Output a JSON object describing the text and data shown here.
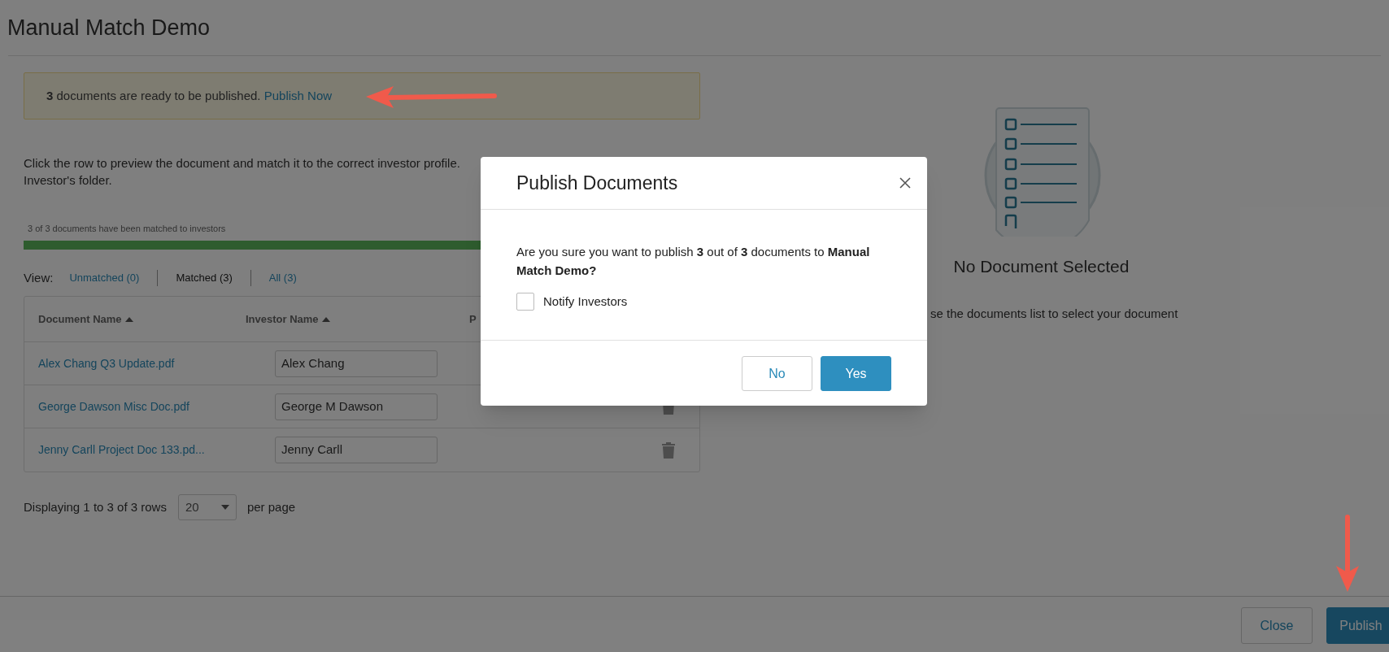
{
  "page": {
    "title": "Manual Match Demo"
  },
  "banner": {
    "message": "**3** documents are ready to be published.",
    "link": "Publish Now"
  },
  "instructions": [
    "Click the row to preview the document and match it to the correct investor profile.",
    "Investor's folder."
  ],
  "progress": {
    "label": "3 of 3 documents have been matched to investors",
    "level": 1
  },
  "view_filter": {
    "label": "View:",
    "options": [
      {
        "label": "Unmatched (0)",
        "selected": false
      },
      {
        "label": "Matched (3)",
        "selected": true
      },
      {
        "label": "All (3)",
        "selected": false
      }
    ]
  },
  "table": {
    "columns": [
      {
        "label": "Document Name",
        "sorted": true
      },
      {
        "label": "Investor Name",
        "sorted": true
      },
      {
        "label": "P",
        "sorted": false
      }
    ],
    "rows": [
      {
        "document": "Alex Chang Q3 Update.pdf",
        "investor": "Alex Chang",
        "trash_icon": false
      },
      {
        "document": "George Dawson Misc Doc.pdf",
        "investor": "George M Dawson",
        "trash_icon": true
      },
      {
        "document": "Jenny Carll Project Doc 133.pd...",
        "investor": "Jenny Carll",
        "trash_icon": true
      }
    ]
  },
  "pagination": {
    "label": "Displaying 1 to 3 of 3 rows",
    "page_size": "20",
    "suffix": "per page"
  },
  "preview": {
    "title": "No Document Selected",
    "hint": "se the documents list to select your document"
  },
  "footer": {
    "buttons": [
      {
        "label": "Close",
        "kind": "secondary"
      },
      {
        "label": "Publish",
        "kind": "primary"
      }
    ]
  },
  "dialog": {
    "title": "Publish Documents",
    "message": "Are you sure you want to publish **3** out of **3** documents to **Manual Match Demo?**",
    "notify": {
      "label": "Notify Investors",
      "checked": false
    },
    "buttons": [
      {
        "label": "No",
        "kind": "secondary"
      },
      {
        "label": "Yes",
        "kind": "primary"
      }
    ]
  }
}
